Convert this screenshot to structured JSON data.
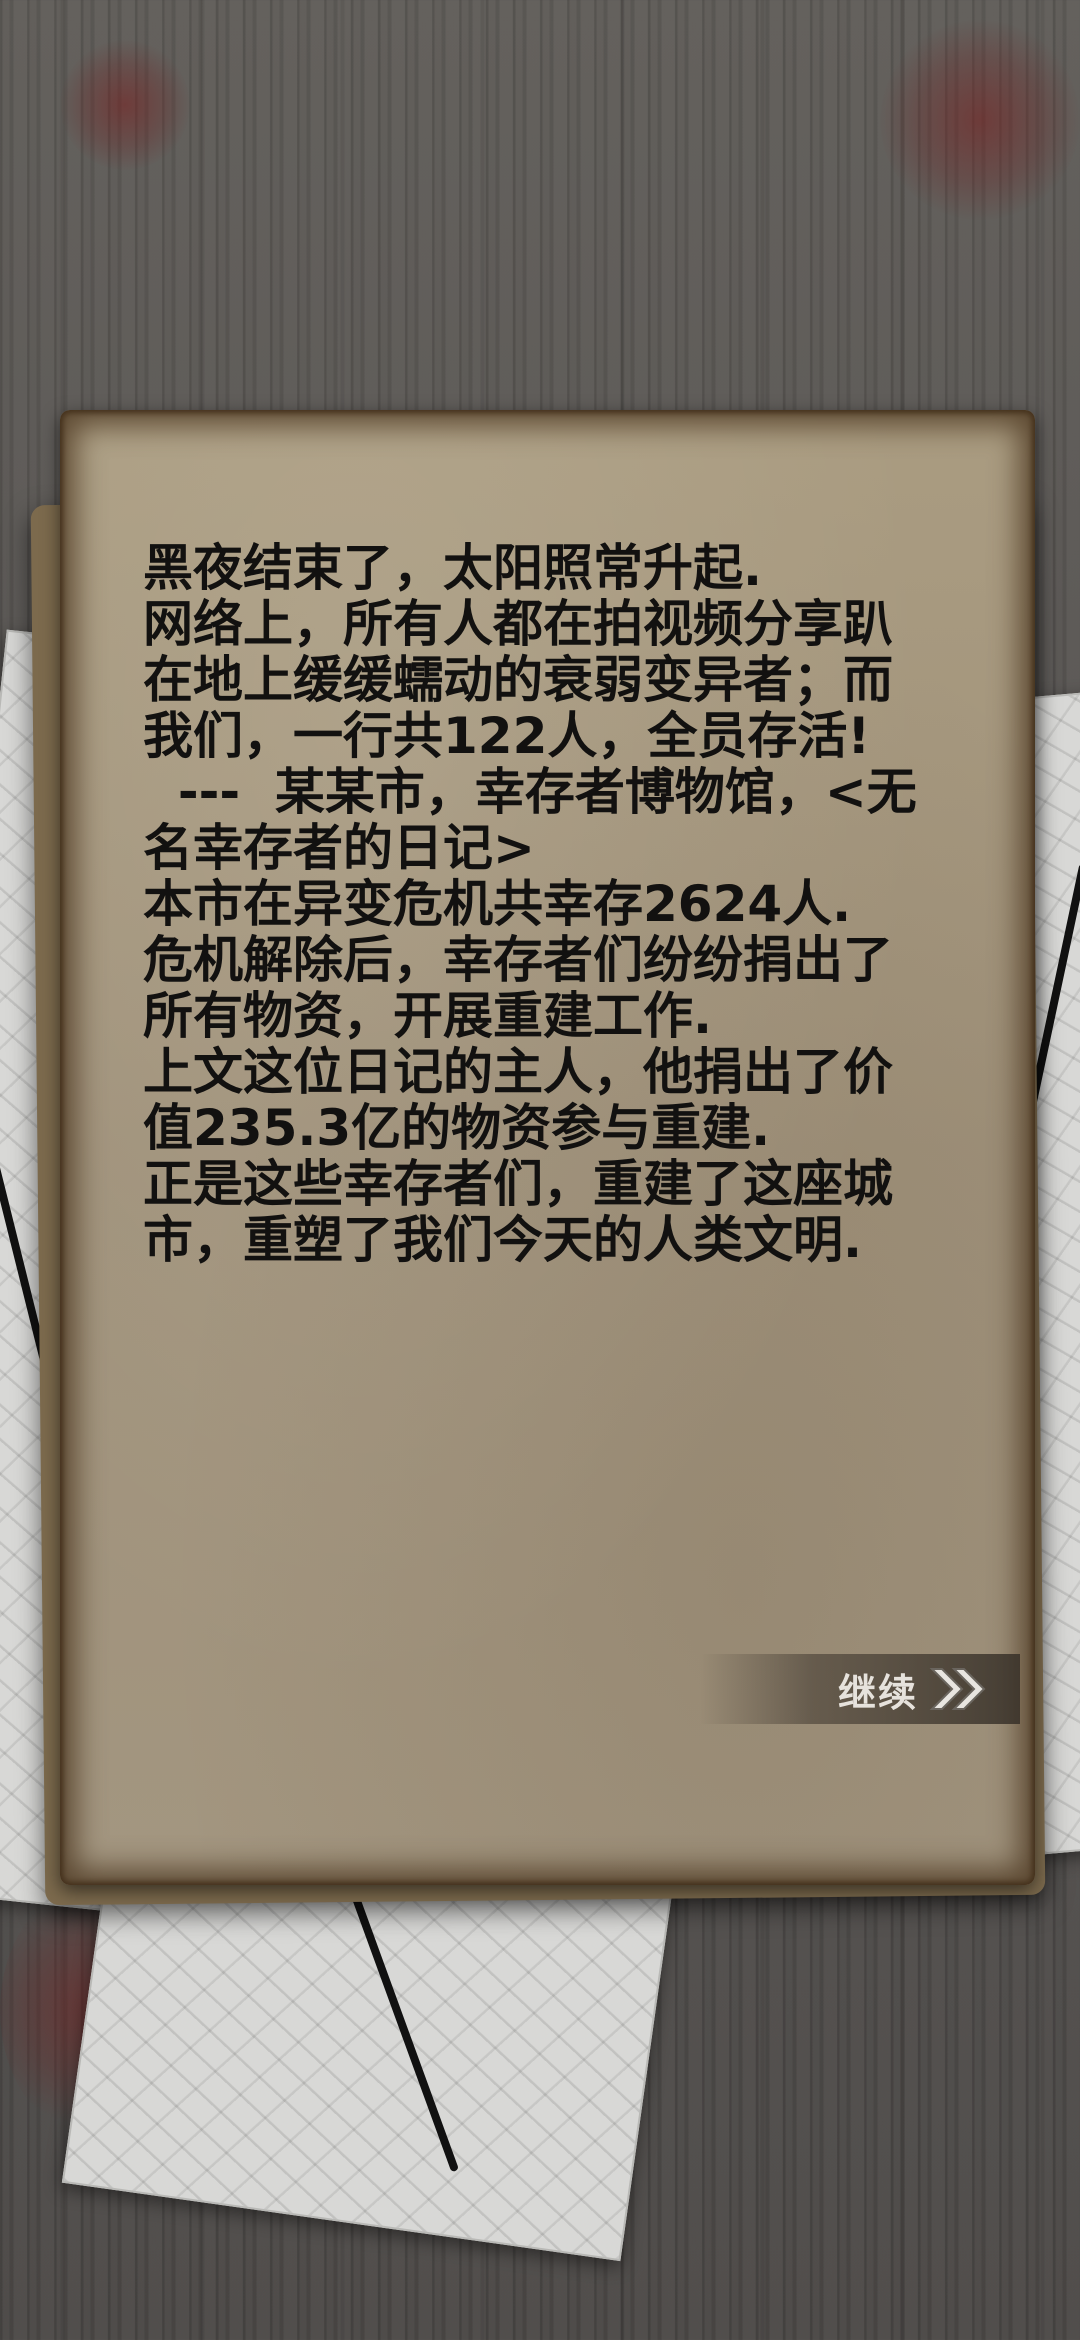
{
  "diary": {
    "lines": [
      "黑夜结束了，太阳照常升起.",
      "网络上，所有人都在拍视频分享趴",
      "在地上缓缓蠕动的衰弱变异者；而",
      "我们，一行共122人，全员存活!",
      "  ---  某某市，幸存者博物馆，<无",
      "名幸存者的日记>",
      "本市在异变危机共幸存2624人.",
      "危机解除后，幸存者们纷纷捐出了",
      "所有物资，开展重建工作.",
      "上文这位日记的主人，他捐出了价",
      "值235.3亿的物资参与重建.",
      "正是这些幸存者们，重建了这座城",
      "市，重塑了我们今天的人类文明."
    ]
  },
  "continue": {
    "label": "继续",
    "icon": "double-chevron-right-icon"
  },
  "colors": {
    "wood": "#555250",
    "paper": "#a39680",
    "text": "#121110",
    "button_text": "#e6e2dc",
    "blood": "#7a1e1e"
  }
}
